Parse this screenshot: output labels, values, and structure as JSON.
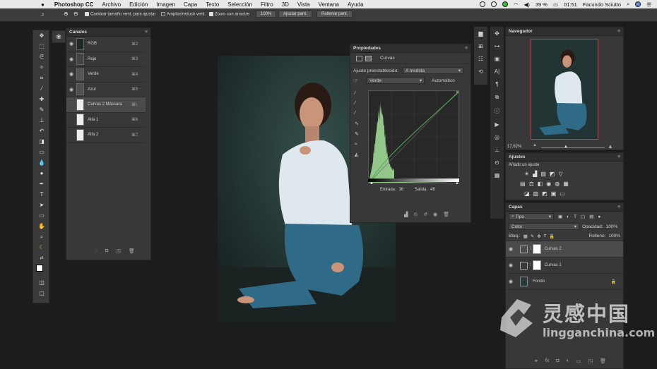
{
  "menubar": {
    "app": "Photoshop CC",
    "items": [
      "Archivo",
      "Edición",
      "Imagen",
      "Capa",
      "Texto",
      "Selección",
      "Filtro",
      "3D",
      "Vista",
      "Ventana",
      "Ayuda"
    ],
    "battery": "39 %",
    "time": "01:51",
    "user": "Facundo Sciutto"
  },
  "options": {
    "resize_windows": "Cambiar tamaño vent. para ajustar",
    "zoom_all": "Ampliar/reducir vent.",
    "scrubby_zoom": "Zoom con arrastre",
    "zoom_value": "100%",
    "fit_button": "Ajustar pant.",
    "fill_button": "Rellenar pant."
  },
  "channels": {
    "title": "Canales",
    "rows": [
      {
        "name": "RGB",
        "key": "⌘2"
      },
      {
        "name": "Rojo",
        "key": "⌘3"
      },
      {
        "name": "Verde",
        "key": "⌘4"
      },
      {
        "name": "Azul",
        "key": "⌘5"
      },
      {
        "name": "Curvas 2 Máscara",
        "key": "⌘\\"
      },
      {
        "name": "Alfa 1",
        "key": "⌘6"
      },
      {
        "name": "Alfa 2",
        "key": "⌘7"
      }
    ]
  },
  "properties": {
    "title": "Propiedades",
    "subtitle": "Curvas",
    "preset_label": "Ajuste preestablecido:",
    "preset_value": "A medida",
    "channel_value": "Verde",
    "auto_button": "Automático",
    "input_label": "Entrada:",
    "input_value": "36",
    "output_label": "Salida:",
    "output_value": "48"
  },
  "navigator": {
    "title": "Navegador",
    "zoom": "17,62%"
  },
  "adjustments": {
    "title": "Ajustes",
    "add_label": "Añadir un ajuste"
  },
  "layers": {
    "title": "Capas",
    "filter": "Tipo",
    "blend_mode": "Color",
    "opacity_label": "Opacidad:",
    "opacity_value": "100%",
    "lock_label": "Bloq.:",
    "fill_label": "Relleno:",
    "fill_value": "100%",
    "items": [
      {
        "name": "Curvas 2"
      },
      {
        "name": "Curvas 1"
      },
      {
        "name": "Fondo"
      }
    ]
  },
  "watermark": {
    "title": "灵感中国",
    "url": "lingganchina.com"
  },
  "colors": {
    "curve_line": "#4caf50",
    "histogram": "#a6e39a",
    "nav_frame": "#d83a3a"
  }
}
